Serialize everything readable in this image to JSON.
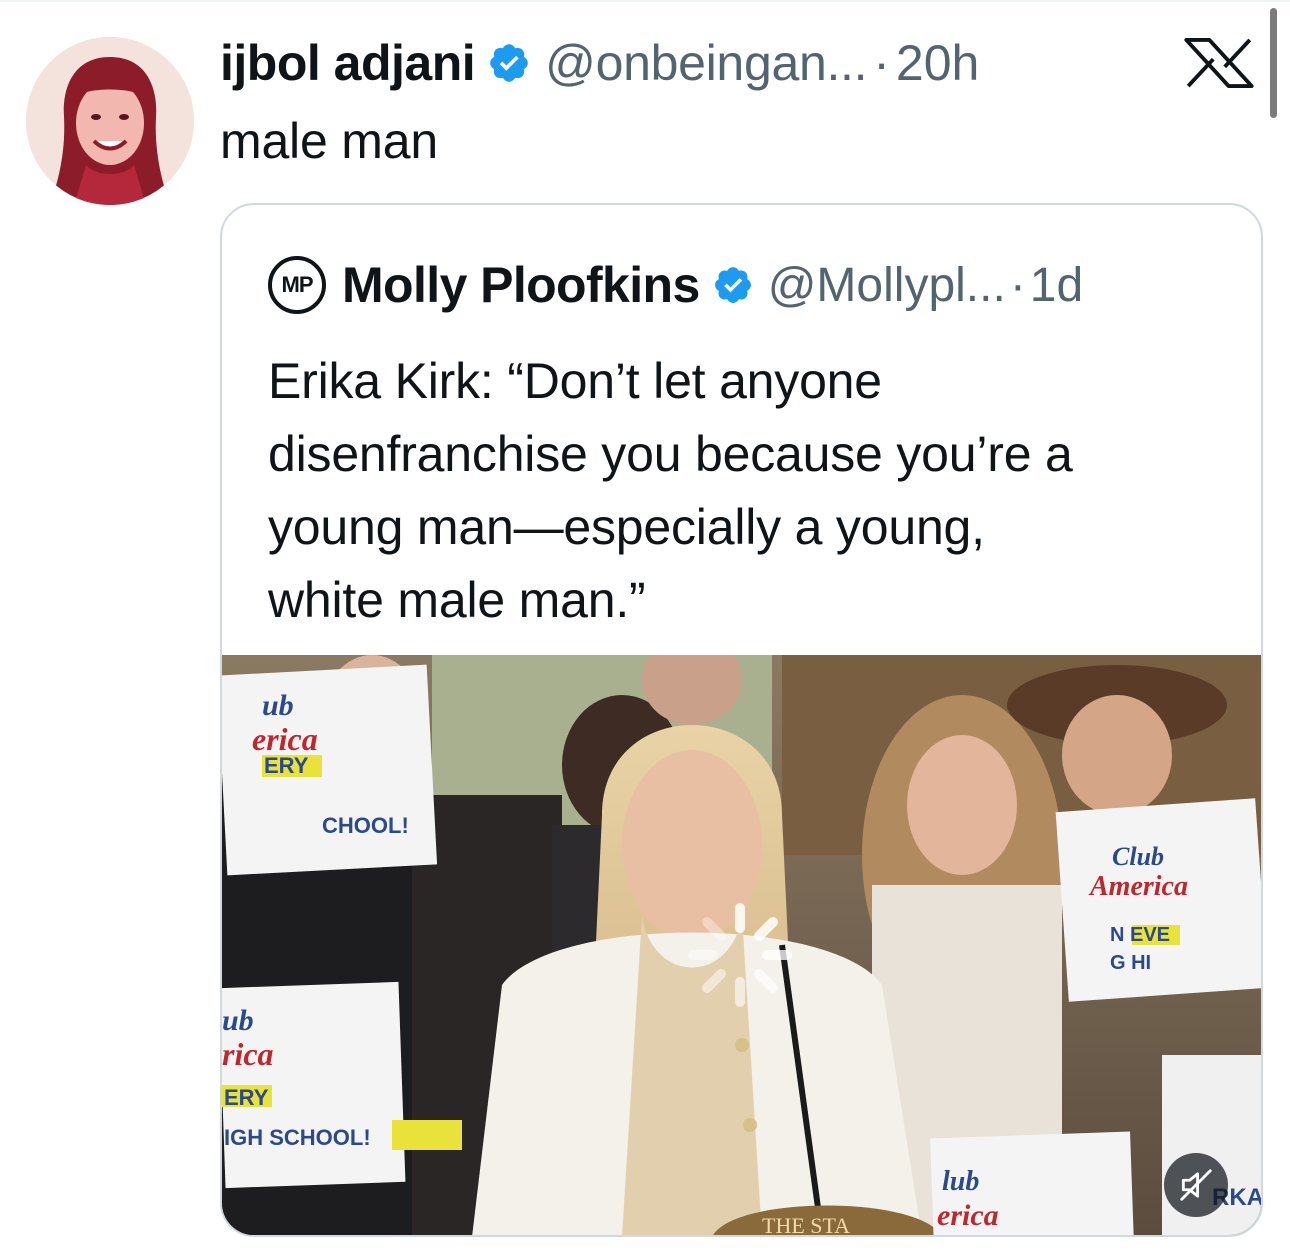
{
  "tweet": {
    "display_name": "ijbol adjani",
    "handle": "@onbeingan...",
    "separator": "·",
    "time": "20h",
    "text": "male man",
    "verified_icon": "verified-badge-icon",
    "avatar_icon": "user-avatar"
  },
  "app": {
    "logo_icon": "x-logo-icon"
  },
  "quote": {
    "avatar_initials": "MP",
    "display_name": "Molly Ploofkins",
    "handle": "@Mollypl...",
    "separator": "·",
    "time": "1d",
    "text_lines": [
      "Erika Kirk: “Don’t let anyone",
      "disenfranchise you because you’re a",
      "young man—especially a young,",
      "white male man.”"
    ],
    "media": {
      "type": "video",
      "state": "loading",
      "spinner_icon": "loading-spinner-icon",
      "mute_icon": "muted-speaker-icon",
      "sign_texts": {
        "sign_top_left": [
          "ub",
          "erica",
          "ERY",
          "CHOOL!"
        ],
        "sign_bottom_left": [
          "ub",
          "rica",
          "ERY",
          "IGH SCHOOL!"
        ],
        "sign_right": [
          "Club",
          "America",
          "N EVE",
          "G HI"
        ],
        "sign_bottom_center": [
          "lub",
          "erica"
        ],
        "seal_text": "THE STA",
        "sign_far_right": "RKA"
      }
    }
  },
  "colors": {
    "verified_blue": "#1d9bf0",
    "secondary_text": "#536471",
    "primary_text": "#0f1419",
    "card_border": "#cfd9de",
    "sign_red": "#c0262d",
    "sign_blue": "#2c4a8a",
    "sign_yellow": "#e8e23a"
  }
}
